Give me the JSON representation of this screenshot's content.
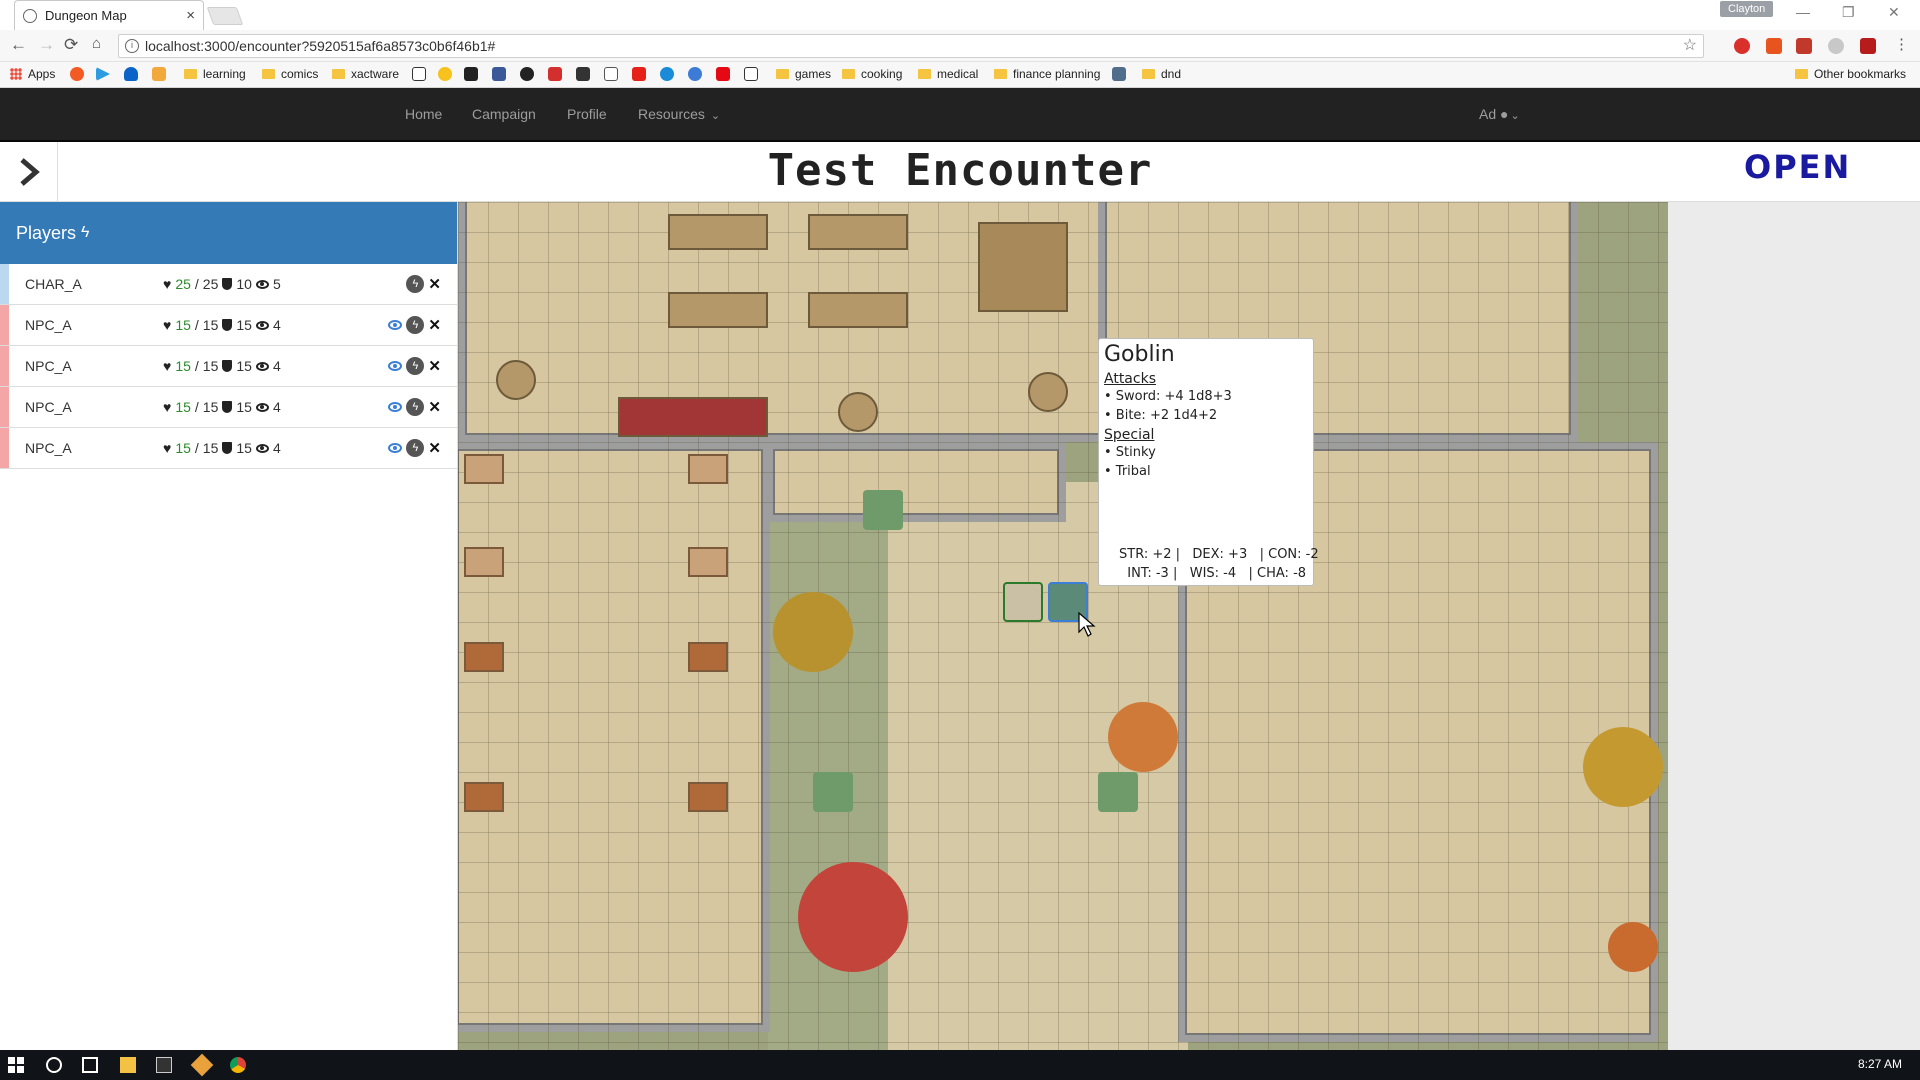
{
  "browser": {
    "tab_title": "Dungeon Map",
    "tab_close": "×",
    "profile_name": "Clayton",
    "url": "localhost:3000/encounter?5920515af6a8573c0b6f46b1#",
    "win_min": "—",
    "win_restore": "❐",
    "win_close": "✕"
  },
  "bookmarks": {
    "apps": "Apps",
    "folders": [
      "learning",
      "comics",
      "xactware",
      "games",
      "cooking",
      "medical",
      "finance planning",
      "dnd"
    ],
    "other": "Other bookmarks"
  },
  "nav": {
    "home": "Home",
    "campaign": "Campaign",
    "profile": "Profile",
    "resources": "Resources",
    "user": "Ad"
  },
  "encounter": {
    "title": "Test Encounter",
    "status": "OPEN"
  },
  "players_panel": {
    "heading": "Players",
    "rows": [
      {
        "name": "CHAR_A",
        "hp": "25",
        "hp_max": "25",
        "ac": "10",
        "perception": "5",
        "bar_color": "#bcd8f0",
        "hidden_toggle": false
      },
      {
        "name": "NPC_A",
        "hp": "15",
        "hp_max": "15",
        "ac": "15",
        "perception": "4",
        "bar_color": "#f4a6a6",
        "hidden_toggle": true
      },
      {
        "name": "NPC_A",
        "hp": "15",
        "hp_max": "15",
        "ac": "15",
        "perception": "4",
        "bar_color": "#f4a6a6",
        "hidden_toggle": true
      },
      {
        "name": "NPC_A",
        "hp": "15",
        "hp_max": "15",
        "ac": "15",
        "perception": "4",
        "bar_color": "#f4a6a6",
        "hidden_toggle": true
      },
      {
        "name": "NPC_A",
        "hp": "15",
        "hp_max": "15",
        "ac": "15",
        "perception": "4",
        "bar_color": "#f4a6a6",
        "hidden_toggle": true
      }
    ]
  },
  "tooltip": {
    "name": "Goblin",
    "attacks_heading": "Attacks",
    "attacks": [
      "• Sword: +4 1d8+3",
      "• Bite: +2 1d4+2"
    ],
    "special_heading": "Special",
    "special": [
      "• Stinky",
      "• Tribal"
    ],
    "stats_line1": "STR: +2 |   DEX: +3   | CON: -2",
    "stats_line2": "  INT: -3 |   WIS: -4   | CHA: -8"
  },
  "taskbar": {
    "clock": "8:27 AM"
  },
  "colors": {
    "navbar": "#222222",
    "panel_header": "#337ab7",
    "status": "#1a1aa0",
    "hp_current": "#2b8a2b"
  }
}
